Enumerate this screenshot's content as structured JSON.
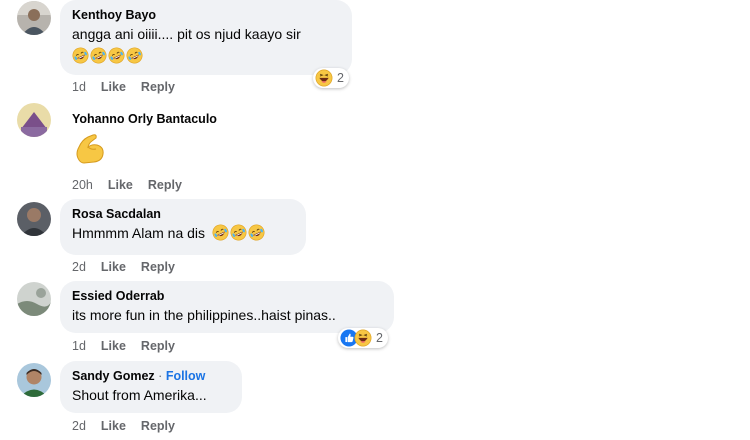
{
  "comments": [
    {
      "author": "Kenthoy Bayo",
      "text": "angga ani oiiii.... pit os njud kaayo sir",
      "emoji_line": "🤣🤣🤣🤣",
      "time": "1d",
      "like": "Like",
      "reply": "Reply",
      "reaction_count": "2",
      "reaction_icons": [
        "laughing-reaction-icon"
      ]
    },
    {
      "author": "Yohanno Orly Bantaculo",
      "emoji": "💪",
      "time": "20h",
      "like": "Like",
      "reply": "Reply"
    },
    {
      "author": "Rosa Sacdalan",
      "text": "Hmmmm Alam na dis",
      "time": "2d",
      "like": "Like",
      "reply": "Reply"
    },
    {
      "author": "Essied Oderrab",
      "text": "its more fun in the philippines..haist pinas..",
      "time": "1d",
      "like": "Like",
      "reply": "Reply",
      "reaction_count": "2",
      "reaction_icons": [
        "like-reaction-icon",
        "laughing-reaction-icon"
      ]
    },
    {
      "author": "Sandy Gomez",
      "separator": "·",
      "follow": "Follow",
      "text": "Shout from Amerika...",
      "time": "2d",
      "like": "Like",
      "reply": "Reply"
    }
  ],
  "colors": {
    "bubble": "#f0f2f5",
    "meta_text": "#65676b",
    "follow_link": "#1b74e4",
    "like_blue": "#1877f2",
    "emoji_yellow": "#f7c744"
  }
}
